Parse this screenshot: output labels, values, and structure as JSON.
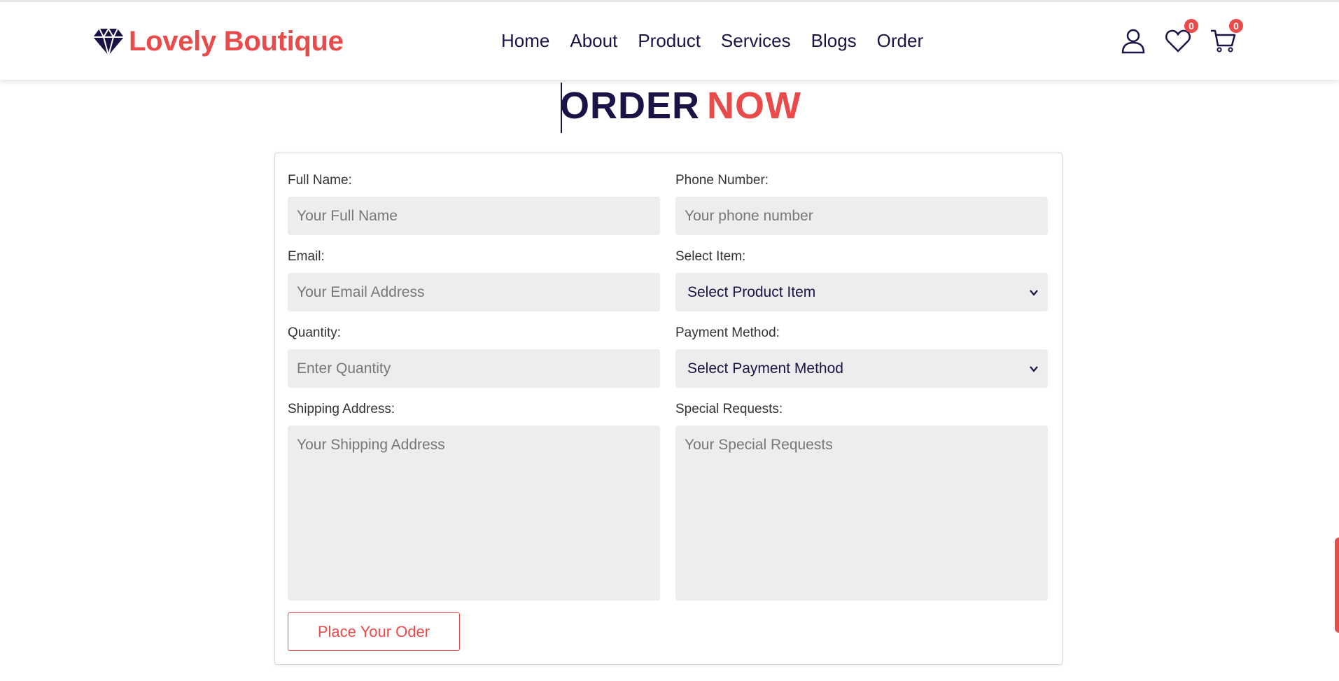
{
  "brand": {
    "name": "Lovely Boutique",
    "logo_icon": "diamond-icon"
  },
  "nav": {
    "items": [
      "Home",
      "About",
      "Product",
      "Services",
      "Blogs",
      "Order"
    ]
  },
  "header_icons": {
    "wishlist_count": "0",
    "cart_count": "0"
  },
  "page_title": {
    "part1": "ORDER",
    "part2": "NOW"
  },
  "form": {
    "full_name": {
      "label": "Full Name:",
      "placeholder": "Your Full Name"
    },
    "phone": {
      "label": "Phone Number:",
      "placeholder": "Your phone number"
    },
    "email": {
      "label": "Email:",
      "placeholder": "Your Email Address"
    },
    "item": {
      "label": "Select Item:",
      "selected": "Select Product Item"
    },
    "quantity": {
      "label": "Quantity:",
      "placeholder": "Enter Quantity"
    },
    "payment": {
      "label": "Payment Method:",
      "selected": "Select Payment Method"
    },
    "shipping": {
      "label": "Shipping Address:",
      "placeholder": "Your Shipping Address"
    },
    "requests": {
      "label": "Special Requests:",
      "placeholder": "Your Special Requests"
    },
    "submit_label": "Place Your Oder"
  },
  "colors": {
    "accent": "#e94b4b",
    "navy": "#1a1446",
    "input_bg": "#ededed"
  }
}
